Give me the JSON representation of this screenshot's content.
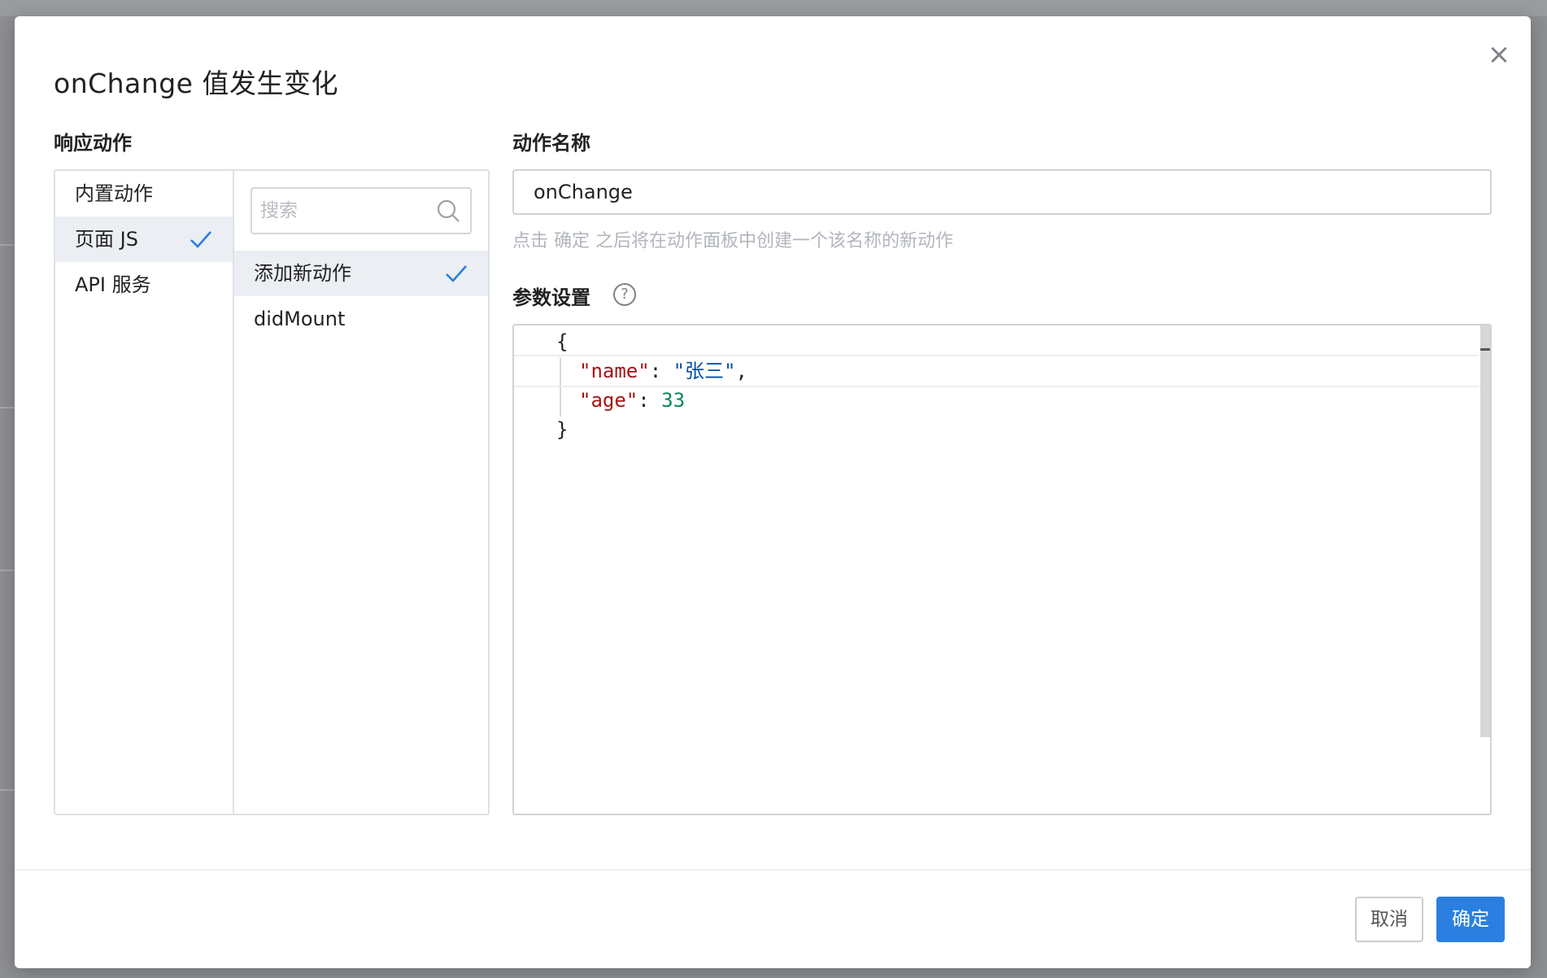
{
  "dialog": {
    "title": "onChange 值发生变化",
    "close_icon": "×"
  },
  "response_actions": {
    "label": "响应动作",
    "categories": [
      {
        "label": "内置动作",
        "selected": false
      },
      {
        "label": "页面 JS",
        "selected": true
      },
      {
        "label": "API 服务",
        "selected": false
      }
    ],
    "search_placeholder": "搜索",
    "actions": [
      {
        "label": "添加新动作",
        "selected": true
      },
      {
        "label": "didMount",
        "selected": false
      }
    ]
  },
  "action_name": {
    "label": "动作名称",
    "value": "onChange",
    "hint": "点击 确定 之后将在动作面板中创建一个该名称的新动作"
  },
  "params": {
    "label": "参数设置",
    "help_icon": "?",
    "code": {
      "open": "{",
      "key1": "\"name\"",
      "colon1": ": ",
      "val1": "\"张三\"",
      "comma1": ",",
      "key2": "\"age\"",
      "colon2": ": ",
      "val2": "33",
      "close": "}"
    }
  },
  "footer": {
    "cancel_label": "取消",
    "ok_label": "确定"
  },
  "colors": {
    "primary": "#2a7fe0",
    "check": "#2a7fe0",
    "code_key": "#a31515",
    "code_string": "#0451a5",
    "code_number": "#098658"
  }
}
